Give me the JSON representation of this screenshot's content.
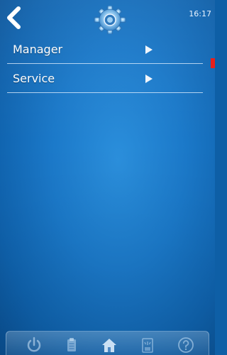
{
  "status": {
    "time": "16:17"
  },
  "menu": {
    "items": [
      {
        "label": "Manager"
      },
      {
        "label": "Service"
      }
    ]
  },
  "icons": {
    "top": [
      "back-chevron-icon",
      "gear-icon"
    ],
    "bottom": [
      "power-icon",
      "clipboard-icon",
      "home-icon",
      "dispense-icon",
      "help-icon"
    ]
  },
  "colors": {
    "background": "#1b79c9",
    "text": "#ffffff",
    "scroll_marker": "#e8201b"
  }
}
